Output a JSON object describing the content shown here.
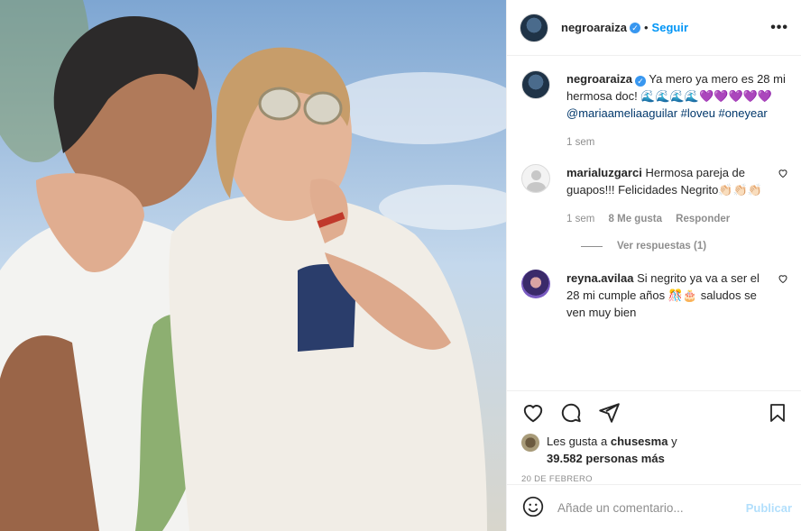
{
  "post": {
    "username": "negroaraiza",
    "follow_label": "Seguir",
    "more_label": "•••"
  },
  "caption": {
    "username": "negroaraiza",
    "text": "Ya mero ya mero es 28 mi hermosa doc! 🌊🌊🌊🌊💜💜💜💜💜",
    "tags": "@mariaameliaaguilar #loveu #oneyear",
    "time": "1 sem"
  },
  "comments": [
    {
      "username": "marialuzgarci",
      "text": "Hermosa pareja de guapos!!! Felicidades Negrito👏🏻👏🏻👏🏻",
      "time": "1 sem",
      "likes": "8 Me gusta",
      "reply_label": "Responder"
    },
    {
      "username": "reyna.avilaa",
      "text": "Si negrito ya va a ser el 28 mi cumple años 🎊🎂 saludos se ven muy bien"
    }
  ],
  "view_replies": "Ver respuestas (1)",
  "likes": {
    "prefix": "Les gusta a",
    "user": "chusesma",
    "conj": "y",
    "count": "39.582 personas más"
  },
  "date": "20 DE FEBRERO",
  "add_comment": {
    "placeholder": "Añade un comentario...",
    "publish_label": "Publicar"
  },
  "colors": {
    "accent": "#0095f6",
    "publish_disabled": "#b2dffc",
    "muted": "#8e8e8e"
  }
}
